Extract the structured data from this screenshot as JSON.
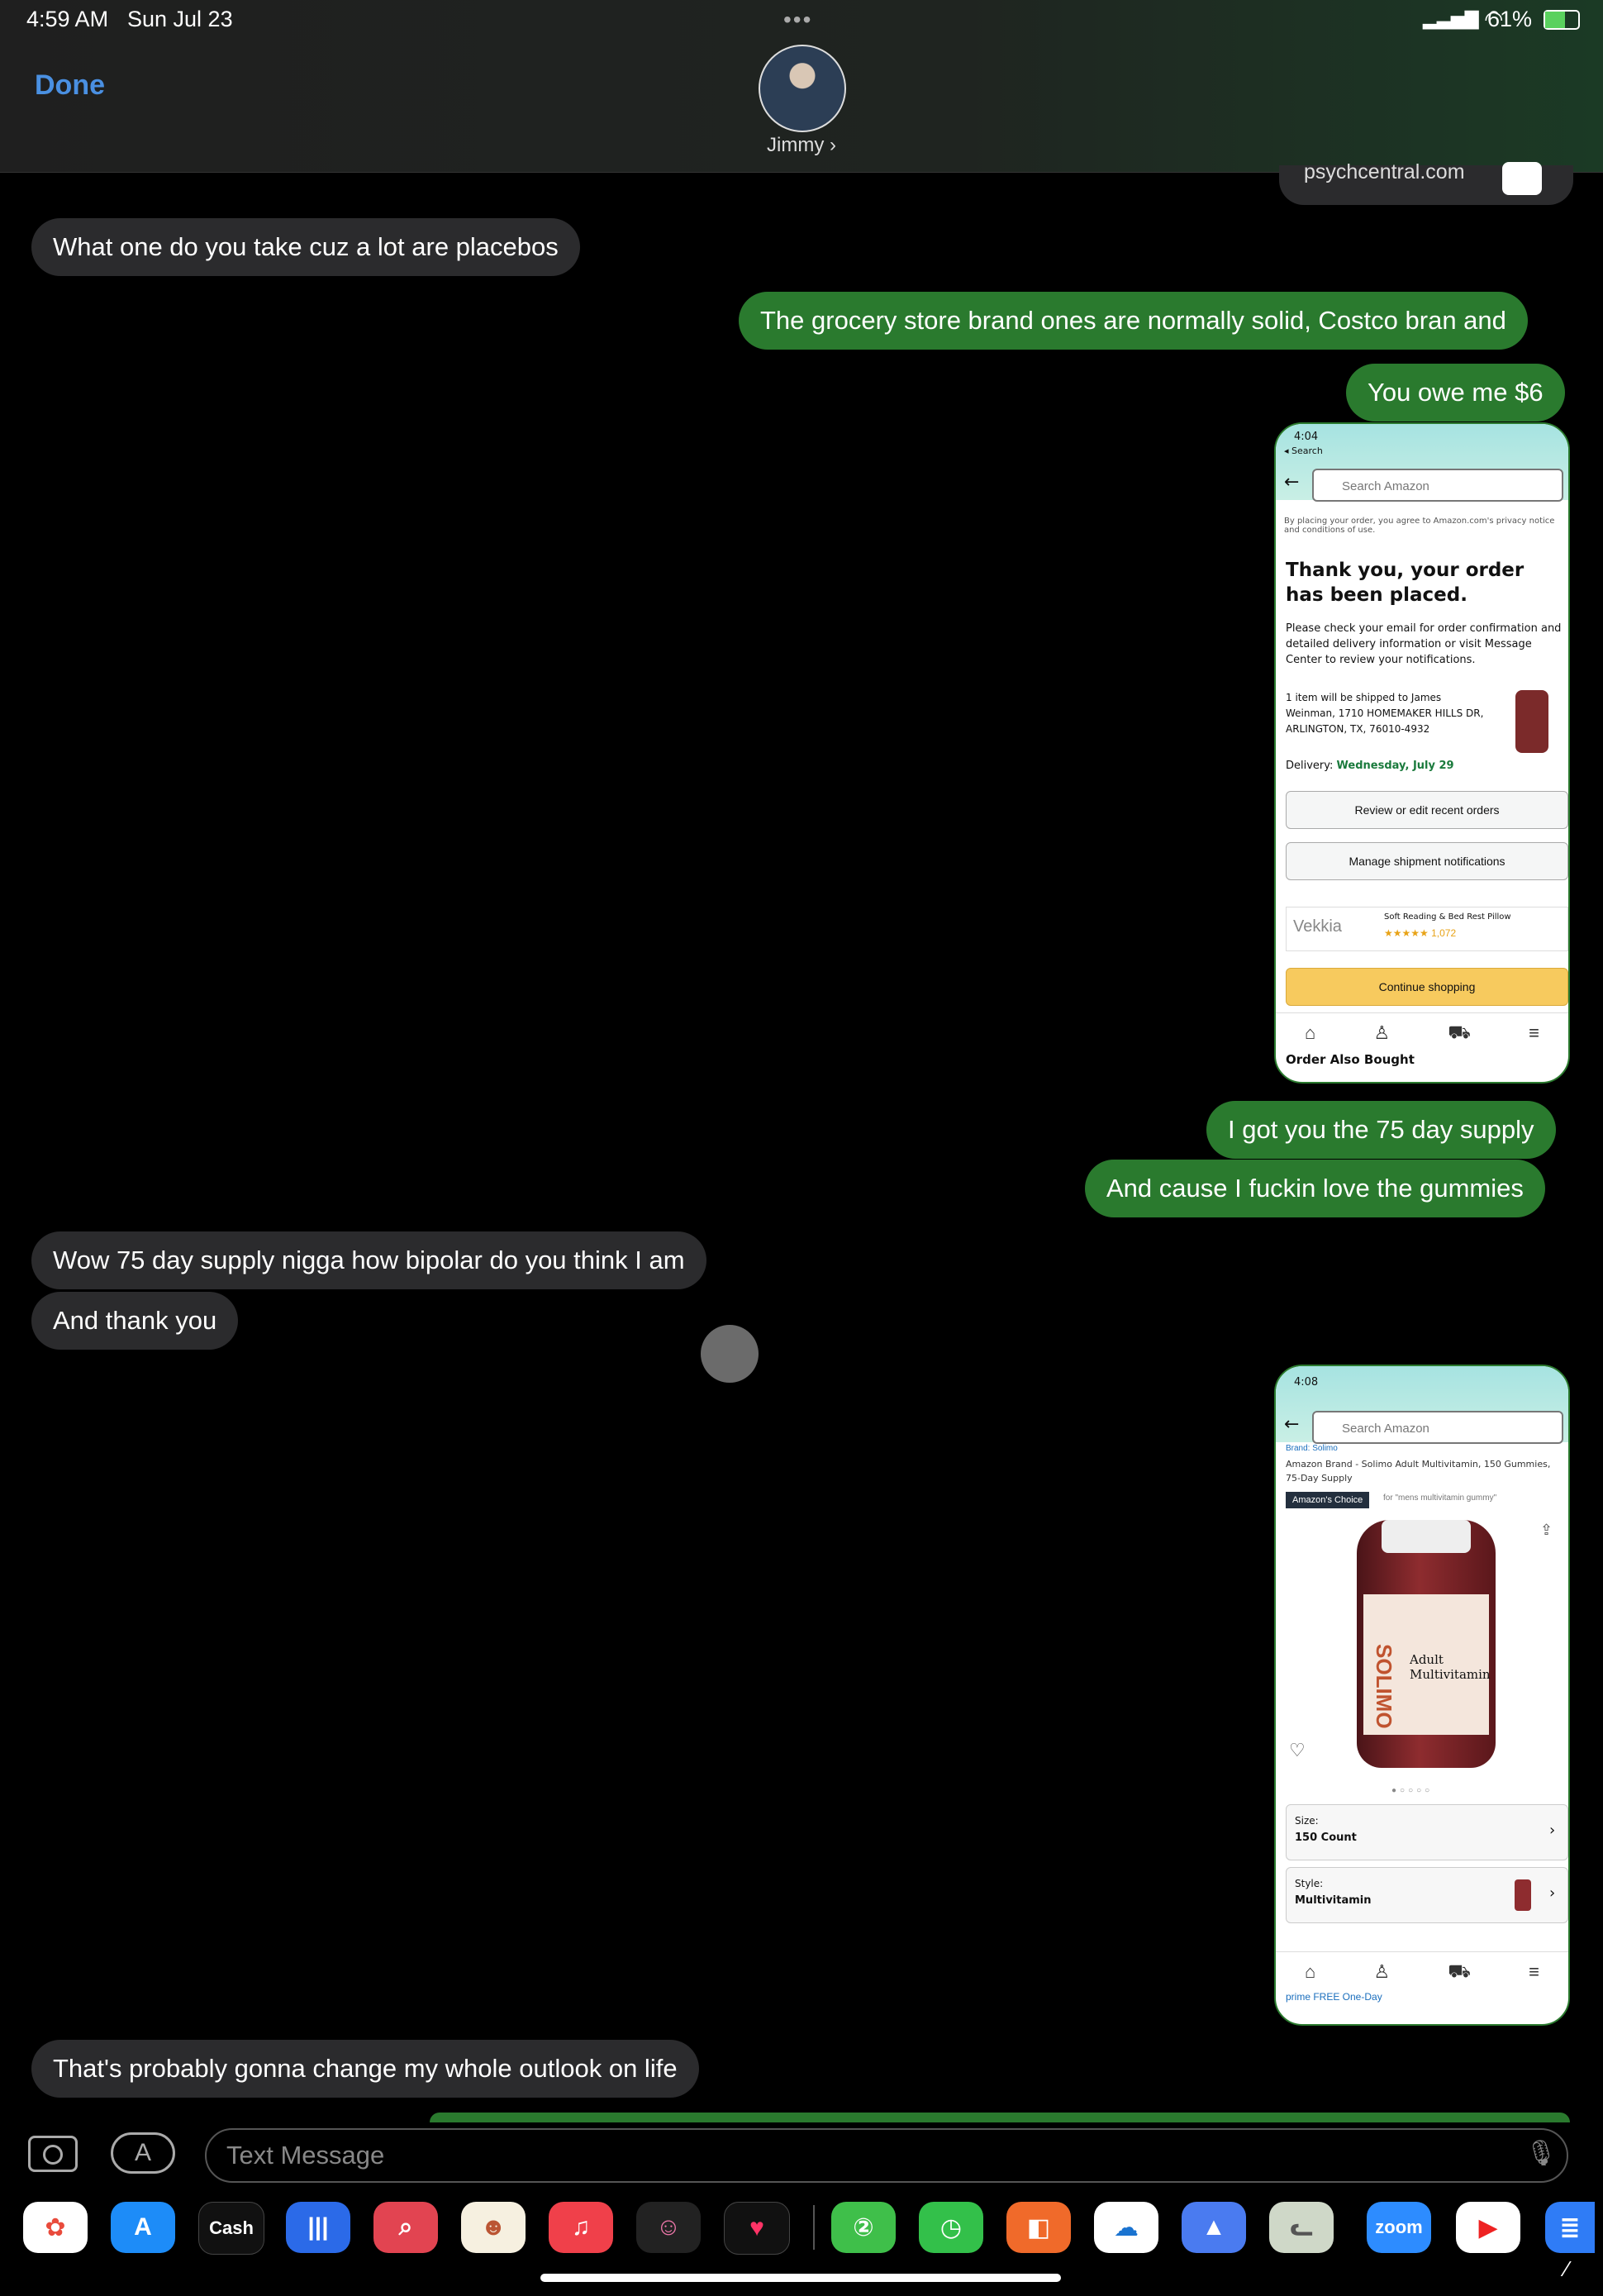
{
  "status_bar": {
    "time": "4:59 AM",
    "date": "Sun Jul 23",
    "battery": "61%"
  },
  "header": {
    "done_label": "Done",
    "contact_name": "Jimmy",
    "contact_chevron": "›"
  },
  "partial_link": {
    "domain": "psychcentral.com"
  },
  "messages": [
    {
      "side": "in",
      "text": "What one do you take cuz a lot are placebos"
    },
    {
      "side": "out",
      "text": "The grocery store brand ones are normally solid, Costco bran and"
    },
    {
      "side": "out",
      "text": "You owe me $6"
    },
    {
      "side": "out",
      "text": "I got you the 75 day supply"
    },
    {
      "side": "out",
      "text": "And cause I fuckin love the gummies"
    },
    {
      "side": "in",
      "text": "Wow 75 day supply nigga how bipolar do you think I am"
    },
    {
      "side": "in",
      "text": "And thank you"
    },
    {
      "side": "in",
      "text": "That's probably gonna change my whole outlook on life"
    }
  ],
  "screenshot1": {
    "time": "4:04",
    "back": "◂ Search",
    "search_placeholder": "Search Amazon",
    "privacy": "By placing your order, you agree to Amazon.com's privacy notice and conditions of use.",
    "heading": "Thank you, your order has been placed.",
    "body": "Please check your email for order confirmation and detailed delivery information or visit Message Center to review your notifications.",
    "shipping": "1 item will be shipped to James Weinman, 1710 HOMEMAKER HILLS DR, ARLINGTON, TX, 76010-4932",
    "delivery_label": "Delivery:",
    "delivery_date": "Wednesday, July 29",
    "btn_review": "Review or edit recent orders",
    "btn_manage": "Manage shipment notifications",
    "ad_brand": "Vekkia",
    "ad_title": "Soft Reading & Bed Rest Pillow",
    "ad_rating": "★★★★★ 1,072",
    "btn_continue": "Continue shopping",
    "footer": "Order Also Bought"
  },
  "screenshot2": {
    "time": "4:08",
    "search_placeholder": "Search Amazon",
    "brand": "Brand: Solimo",
    "title": "Amazon Brand - Solimo Adult Multivitamin, 150 Gummies, 75-Day Supply",
    "badge": "Amazon's Choice",
    "badge_for": "for \"mens multivitamin gummy\"",
    "label_brand": "SOLIMO",
    "label_product": "Adult Multivitamin",
    "size_label": "Size:",
    "size_value": "150 Count",
    "style_label": "Style:",
    "style_value": "Multivitamin",
    "footer": "prime FREE One-Day"
  },
  "input": {
    "placeholder": "Text Message"
  },
  "dock": [
    "Photos",
    "App Store",
    "Cash",
    "Voice Memos",
    "Search",
    "Game",
    "Music",
    "Memoji",
    "Health",
    "Messages",
    "Clock",
    "Office",
    "OneDrive",
    "Dropbox",
    "Pusheen",
    "zoom",
    "YouTube",
    "Files"
  ],
  "dock_labels": {
    "cash": "Cash",
    "zoom": "zoom"
  }
}
